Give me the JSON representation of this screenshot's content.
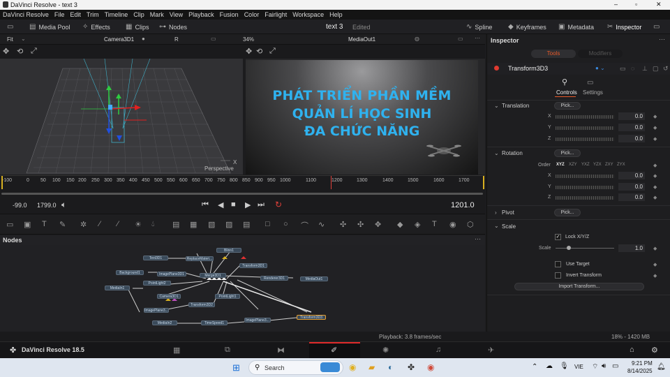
{
  "window": {
    "title": "DaVinci Resolve - text 3"
  },
  "menu": [
    "DaVinci Resolve",
    "File",
    "Edit",
    "Trim",
    "Timeline",
    "Clip",
    "Mark",
    "View",
    "Playback",
    "Fusion",
    "Color",
    "Fairlight",
    "Workspace",
    "Help"
  ],
  "toolbar": {
    "media_pool": "Media Pool",
    "effects": "Effects",
    "clips": "Clips",
    "nodes": "Nodes",
    "project": "text 3",
    "status": "Edited",
    "spline": "Spline",
    "keyframes": "Keyframes",
    "metadata": "Metadata",
    "inspector": "Inspector"
  },
  "viewer": {
    "fit": "Fit",
    "left_name": "Camera3D1",
    "left_mode": "R",
    "zoom": "34%",
    "right_name": "MediaOut1",
    "axis_label": "X",
    "perspective": "Perspective"
  },
  "preview": {
    "line1": "PHÁT TRIỂN PHẦN MỀM",
    "line2": "QUẢN LÍ HỌC SINH",
    "line3": "ĐA CHỨC NĂNG"
  },
  "ruler": [
    "-100",
    "0",
    "50",
    "100",
    "150",
    "200",
    "250",
    "300",
    "350",
    "400",
    "450",
    "500",
    "550",
    "600",
    "650",
    "700",
    "750",
    "800",
    "850",
    "900",
    "950",
    "1000",
    "1100",
    "1200",
    "1300",
    "1400",
    "1500",
    "1600",
    "1700"
  ],
  "transport": {
    "start": "-99.0",
    "end": "1799.0",
    "current": "1201.0"
  },
  "nodes": {
    "title": "Nodes",
    "items": [
      "Blinn1",
      "Text3D1",
      "ReplaceMateri...",
      "Transform3D1",
      "Background1",
      "ImagePlane3D1",
      "Merge3D1",
      "Renderer3D1",
      "MediaOut1",
      "MediaIn1",
      "PointLight2",
      "Camera3D1",
      "PointLight1",
      "ImagePlane3...",
      "Transform3D2",
      "MediaIn2",
      "TimeSpeed1",
      "ImagePlane3...",
      "Transform3D3"
    ]
  },
  "inspector": {
    "title": "Inspector",
    "tab_tools": "Tools",
    "tab_modifiers": "Modifiers",
    "node_name": "Transform3D3",
    "controls": "Controls",
    "settings": "Settings",
    "translation": "Translation",
    "rotation": "Rotation",
    "pivot": "Pivot",
    "scale": "Scale",
    "pick": "Pick...",
    "x": "X",
    "y": "Y",
    "z": "Z",
    "tx": "0.0",
    "ty": "0.0",
    "tz": "0.0",
    "rx": "0.0",
    "ry": "0.0",
    "rz": "0.0",
    "order_label": "Order",
    "orders": [
      "XYZ",
      "XZY",
      "YXZ",
      "YZX",
      "ZXY",
      "ZYX"
    ],
    "lock": "Lock X/Y/Z",
    "scale_label": "Scale",
    "scale_value": "1.0",
    "use_target": "Use Target",
    "invert": "Invert Transform",
    "import": "Import Transform..."
  },
  "status": {
    "playback": "Playback: 3.8 frames/sec",
    "memory": "18% - 1420 MB"
  },
  "page": {
    "app": "DaVinci Resolve 18.5"
  },
  "taskbar": {
    "search": "Search",
    "lang": "VIE",
    "time": "9:21 PM",
    "date": "8/14/2025"
  }
}
